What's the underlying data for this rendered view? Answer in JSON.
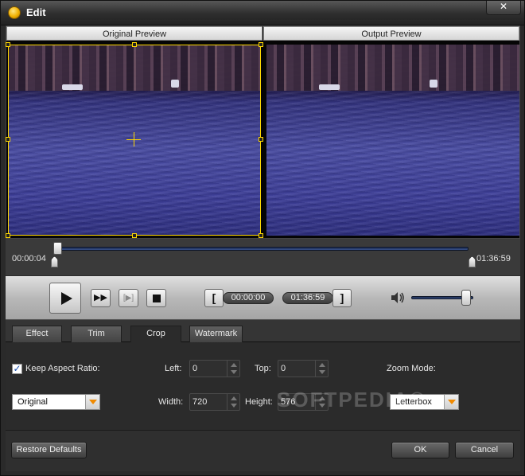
{
  "window": {
    "title": "Edit",
    "close_label": "✕",
    "icon": "app-icon"
  },
  "preview": {
    "original_label": "Original Preview",
    "output_label": "Output Preview"
  },
  "timeline": {
    "start_time": "00:00:04",
    "end_time": "01:36:59",
    "position_fraction": 0.0
  },
  "controls": {
    "play_icon": "play-icon",
    "fast_forward_label": "▶▶",
    "next_frame_label": "[▶]",
    "stop_icon": "stop-icon",
    "set_start_label": "[",
    "set_end_label": "]",
    "trim_start_time": "00:00:00",
    "trim_end_time": "01:36:59",
    "volume_icon": "speaker-icon",
    "volume_fraction": 0.95
  },
  "tabs": [
    {
      "label": "Effect"
    },
    {
      "label": "Trim"
    },
    {
      "label": "Crop",
      "active": true
    },
    {
      "label": "Watermark"
    }
  ],
  "crop": {
    "keep_aspect_label": "Keep Aspect Ratio:",
    "keep_aspect_checked": true,
    "aspect_value": "Original",
    "left_label": "Left:",
    "left_value": "0",
    "top_label": "Top:",
    "top_value": "0",
    "width_label": "Width:",
    "width_value": "720",
    "height_label": "Height:",
    "height_value": "576",
    "zoom_mode_label": "Zoom Mode:",
    "zoom_mode_value": "Letterbox"
  },
  "watermark_overlay": "SOFTPEDIA®",
  "footer": {
    "restore_label": "Restore Defaults",
    "ok_label": "OK",
    "cancel_label": "Cancel"
  },
  "colors": {
    "crop_frame": "#ffd800",
    "dropdown_arrow": "#f08a00",
    "checkbox_mark": "#1a4fb0"
  }
}
